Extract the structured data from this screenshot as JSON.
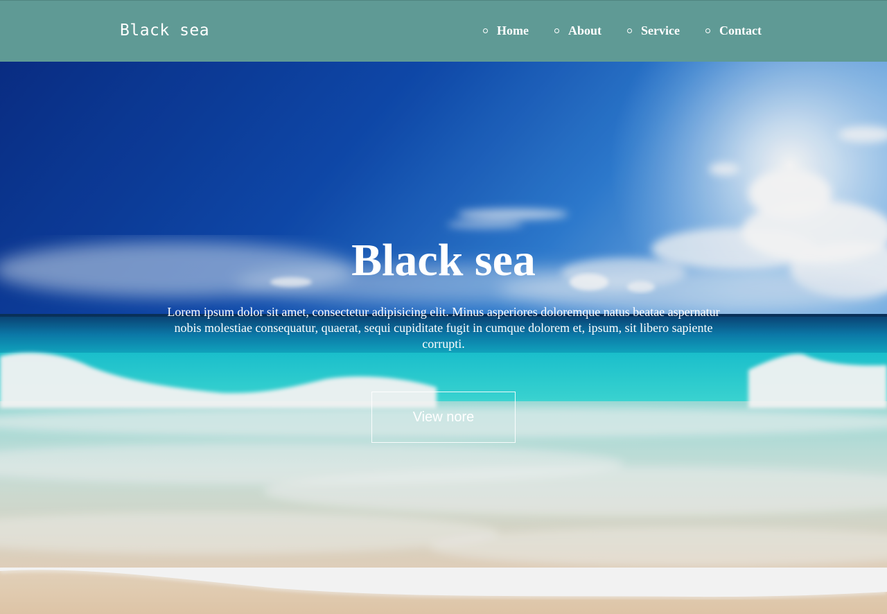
{
  "header": {
    "logo": "Black sea",
    "background_color": "#5f9a95",
    "nav": [
      {
        "label": "Home",
        "icon": "circle-bullet-icon"
      },
      {
        "label": "About",
        "icon": "circle-bullet-icon"
      },
      {
        "label": "Service",
        "icon": "circle-bullet-icon"
      },
      {
        "label": "Contact",
        "icon": "circle-bullet-icon"
      }
    ]
  },
  "hero": {
    "title": "Black sea",
    "description": "Lorem ipsum dolor sit amet, consectetur adipisicing elit. Minus asperiores doloremque natus beatae aspernatur nobis molestiae consequatur, quaerat, sequi cupiditate fugit in cumque dolorem et, ipsum, sit libero sapiente corrupti.",
    "button_label": "View nore",
    "background": "beach-photo"
  }
}
